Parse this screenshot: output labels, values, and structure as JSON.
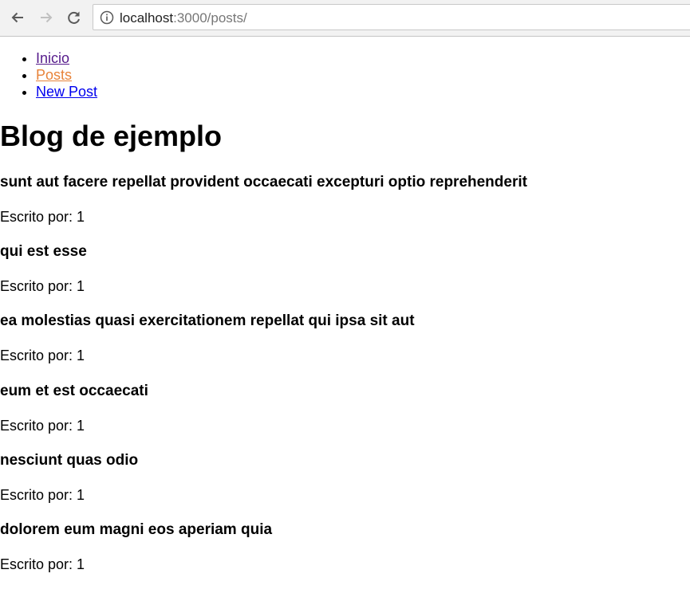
{
  "browser": {
    "url_host": "localhost",
    "url_rest": ":3000/posts/"
  },
  "nav": {
    "items": [
      {
        "label": "Inicio"
      },
      {
        "label": "Posts"
      },
      {
        "label": "New Post"
      }
    ]
  },
  "page": {
    "title": "Blog de ejemplo"
  },
  "posts": [
    {
      "title": "sunt aut facere repellat provident occaecati excepturi optio reprehenderit",
      "author": "Escrito por: 1"
    },
    {
      "title": "qui est esse",
      "author": "Escrito por: 1"
    },
    {
      "title": "ea molestias quasi exercitationem repellat qui ipsa sit aut",
      "author": "Escrito por: 1"
    },
    {
      "title": "eum et est occaecati",
      "author": "Escrito por: 1"
    },
    {
      "title": "nesciunt quas odio",
      "author": "Escrito por: 1"
    },
    {
      "title": "dolorem eum magni eos aperiam quia",
      "author": "Escrito por: 1"
    }
  ],
  "colors": {
    "link_visited": "#551a8b",
    "link_active": "#e8833a",
    "link_normal": "#0000ee"
  }
}
